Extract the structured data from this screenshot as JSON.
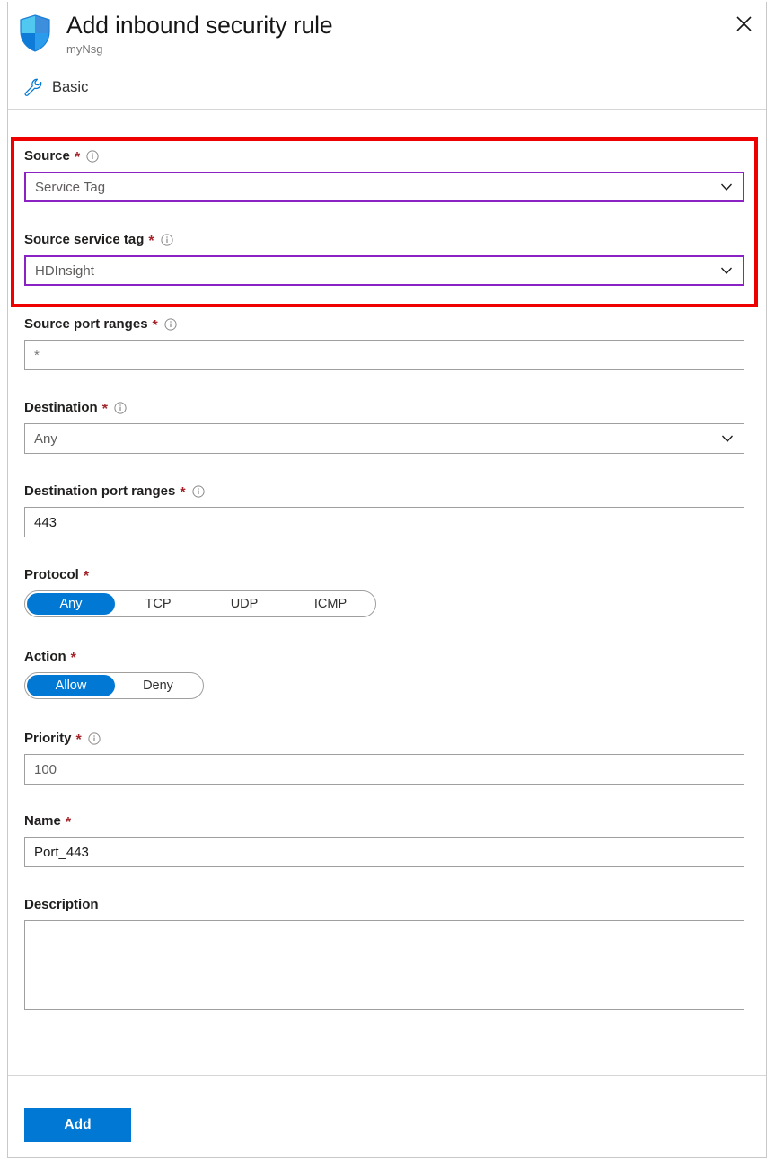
{
  "header": {
    "title": "Add inbound security rule",
    "subtitle": "myNsg",
    "shield_icon": "shield-icon",
    "close_icon": "close-icon",
    "command": {
      "label": "Basic",
      "icon": "wrench-icon"
    }
  },
  "highlight": {
    "color": "#ee0000"
  },
  "accent": {
    "primary": "#0078d4",
    "focus_border": "#8b23c4",
    "required_star": "#a4262c"
  },
  "form": {
    "source": {
      "label": "Source",
      "required": "*",
      "info_icon": "info-icon",
      "value": "Service Tag",
      "chevron_icon": "chevron-down-icon"
    },
    "source_service_tag": {
      "label": "Source service tag",
      "required": "*",
      "info_icon": "info-icon",
      "value": "HDInsight",
      "chevron_icon": "chevron-down-icon"
    },
    "source_port_ranges": {
      "label": "Source port ranges",
      "required": "*",
      "info_icon": "info-icon",
      "value": "*"
    },
    "destination": {
      "label": "Destination",
      "required": "*",
      "info_icon": "info-icon",
      "value": "Any",
      "chevron_icon": "chevron-down-icon"
    },
    "destination_port_ranges": {
      "label": "Destination port ranges",
      "required": "*",
      "info_icon": "info-icon",
      "value": "443"
    },
    "protocol": {
      "label": "Protocol",
      "required": "*",
      "options": [
        "Any",
        "TCP",
        "UDP",
        "ICMP"
      ],
      "selected": "Any"
    },
    "action": {
      "label": "Action",
      "required": "*",
      "options": [
        "Allow",
        "Deny"
      ],
      "selected": "Allow"
    },
    "priority": {
      "label": "Priority",
      "required": "*",
      "info_icon": "info-icon",
      "value": "100"
    },
    "name": {
      "label": "Name",
      "required": "*",
      "value": "Port_443"
    },
    "description": {
      "label": "Description",
      "value": ""
    }
  },
  "footer": {
    "add_label": "Add"
  }
}
